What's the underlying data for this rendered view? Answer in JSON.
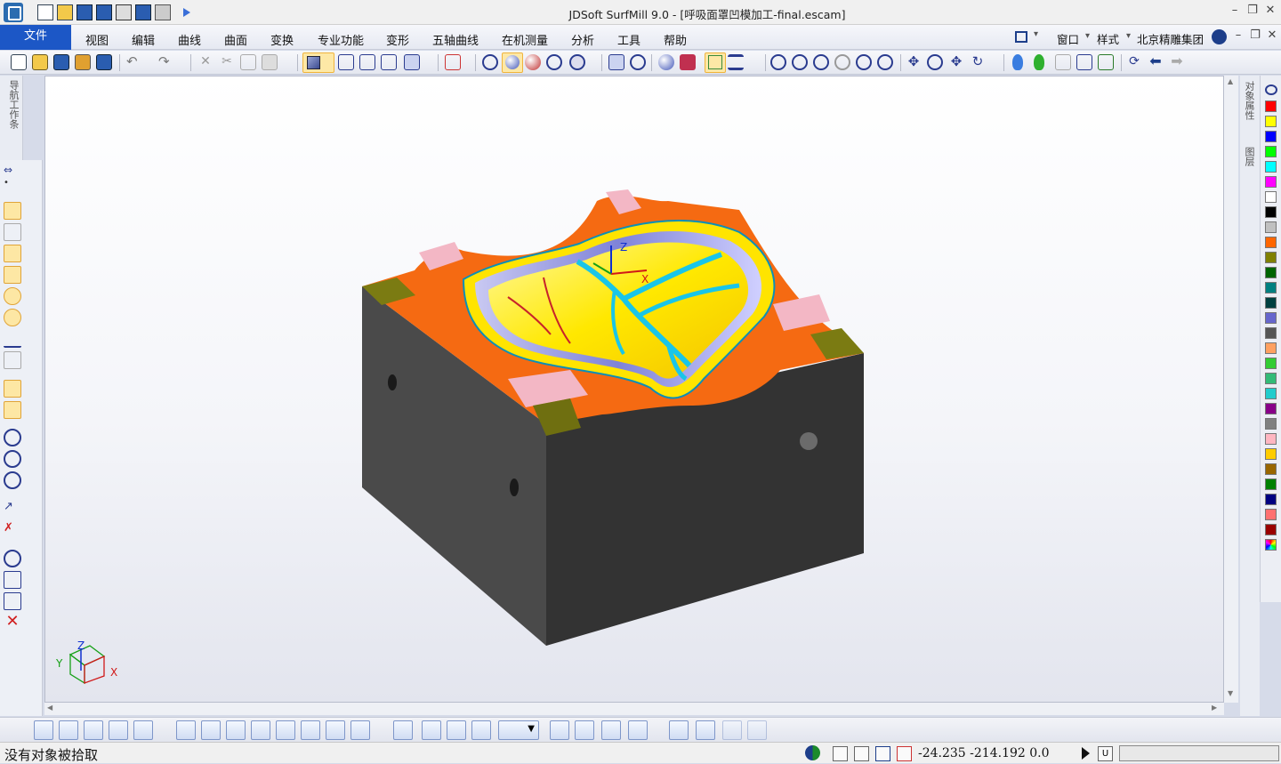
{
  "app": {
    "title": "JDSoft SurfMill 9.0 - [呼吸面罩凹模加工-final.escam]"
  },
  "menu": {
    "file": "文件",
    "items": [
      "视图",
      "编辑",
      "曲线",
      "曲面",
      "变换",
      "专业功能",
      "变形",
      "五轴曲线",
      "在机测量",
      "分析",
      "工具",
      "帮助"
    ],
    "right": {
      "window": "窗口",
      "style": "样式",
      "company": "北京精雕集团"
    }
  },
  "panels": {
    "left_tab": "导航工作条",
    "right_tab_props": "对象属性",
    "right_tab_layers": "图层"
  },
  "viewport": {
    "csys_labels": {
      "z": "Z",
      "y": "Y",
      "x": "X"
    },
    "model_axis_labels": {
      "z": "Z",
      "x": "X"
    }
  },
  "palette": {
    "colors": [
      "#ff0000",
      "#ffff00",
      "#0000ff",
      "#00ff00",
      "#00ffff",
      "#ff00ff",
      "#ffffff",
      "#000000",
      "#c0c0c0",
      "#ff6600",
      "#808000",
      "#006400",
      "#008080",
      "#004040",
      "#6666cc",
      "#555555",
      "#ffa060",
      "#33cc33",
      "#33bb77",
      "#22cccc",
      "#880088",
      "#808080",
      "#ffb6c1",
      "#ffcc00",
      "#996600",
      "#008000",
      "#000080",
      "#ff7070",
      "#990000",
      "#multicolor"
    ]
  },
  "status": {
    "message": "没有对象被拾取",
    "coordinates": "-24.235 -214.192 0.0",
    "mode_letter": "U"
  }
}
